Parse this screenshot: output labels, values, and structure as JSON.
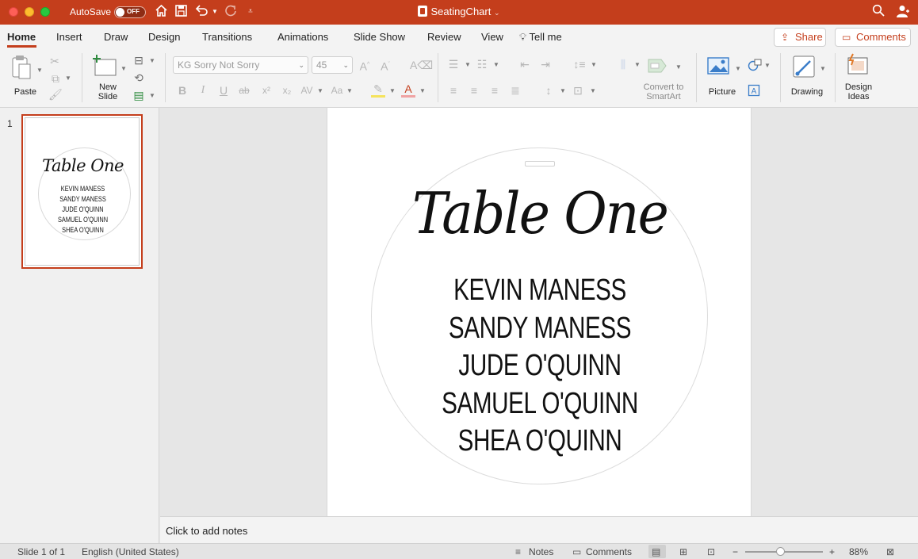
{
  "window": {
    "autosave_label": "AutoSave",
    "autosave_state": "OFF",
    "document_title": "SeatingChart",
    "accent_color": "#c43e1c"
  },
  "tabs": [
    {
      "label": "Home"
    },
    {
      "label": "Insert"
    },
    {
      "label": "Draw"
    },
    {
      "label": "Design"
    },
    {
      "label": "Transitions"
    },
    {
      "label": "Animations"
    },
    {
      "label": "Slide Show"
    },
    {
      "label": "Review"
    },
    {
      "label": "View"
    },
    {
      "label": "Tell me"
    }
  ],
  "header_buttons": {
    "share": "Share",
    "comments": "Comments"
  },
  "ribbon": {
    "paste": "Paste",
    "new_slide_line1": "New",
    "new_slide_line2": "Slide",
    "font_name": "KG Sorry Not Sorry",
    "font_size": "45",
    "convert_line1": "Convert to",
    "convert_line2": "SmartArt",
    "picture": "Picture",
    "drawing": "Drawing",
    "design_ideas_line1": "Design",
    "design_ideas_line2": "Ideas"
  },
  "thumbnail": {
    "slide_number": "1",
    "title": "Table One",
    "names": [
      "KEVIN MANESS",
      "SANDY MANESS",
      "JUDE O'QUINN",
      "SAMUEL O'QUINN",
      "SHEA O'QUINN"
    ]
  },
  "slide": {
    "title": "Table One",
    "names": [
      "KEVIN MANESS",
      "SANDY MANESS",
      "JUDE O'QUINN",
      "SAMUEL O'QUINN",
      "SHEA O'QUINN"
    ]
  },
  "notes": {
    "placeholder": "Click to add notes"
  },
  "status": {
    "slide_counter": "Slide 1 of 1",
    "language": "English (United States)",
    "notes": "Notes",
    "comments": "Comments",
    "zoom_minus": "−",
    "zoom_plus": "+",
    "zoom": "88%"
  }
}
